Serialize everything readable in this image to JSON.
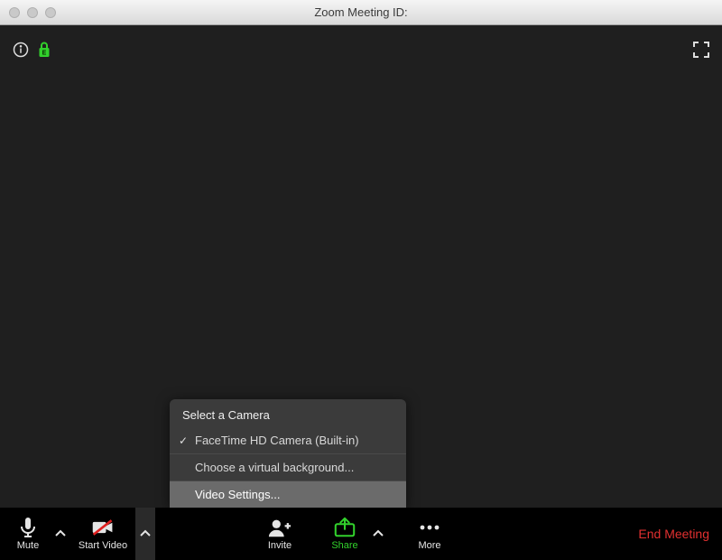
{
  "titlebar": {
    "title": "Zoom Meeting ID:"
  },
  "topbar": {
    "info_icon": "info-icon",
    "encryption_icon": "encryption-lock-icon",
    "encryption_letter": "E",
    "fullscreen_icon": "enter-fullscreen-icon"
  },
  "popup": {
    "header": "Select a Camera",
    "items": [
      {
        "label": "FaceTime HD Camera (Built-in)",
        "checked": true
      },
      {
        "label": "Choose a virtual background..."
      },
      {
        "label": "Video Settings...",
        "highlighted": true
      }
    ]
  },
  "controls": {
    "mute": {
      "label": "Mute"
    },
    "start_video": {
      "label": "Start Video"
    },
    "invite": {
      "label": "Invite"
    },
    "share": {
      "label": "Share"
    },
    "more": {
      "label": "More"
    },
    "end": {
      "label": "End Meeting"
    }
  },
  "colors": {
    "accent_green": "#32d12c",
    "end_red": "#e23030"
  }
}
